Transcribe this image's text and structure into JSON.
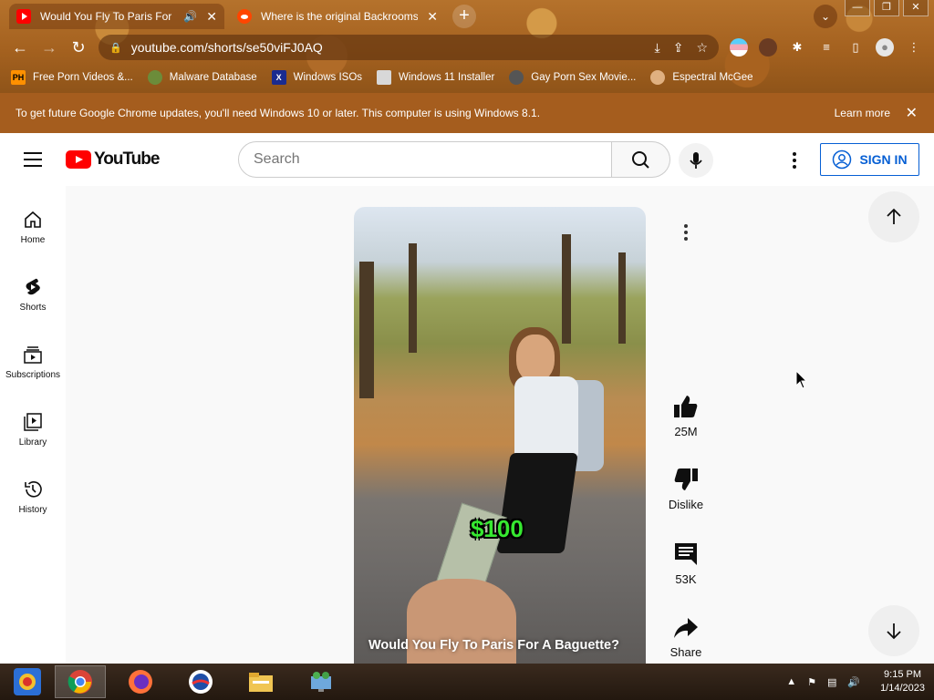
{
  "browser": {
    "tabs": [
      {
        "title": "Would You Fly To Paris For A",
        "favicon": "youtube-favicon",
        "audio": true,
        "active": true
      },
      {
        "title": "Where is the original Backrooms",
        "favicon": "reddit-favicon",
        "audio": false,
        "active": false
      }
    ],
    "new_tab_label": "+",
    "url": "youtube.com/shorts/se50viFJ0AQ",
    "bookmarks": [
      {
        "label": "Free Porn Videos &...",
        "icon": "ph-icon"
      },
      {
        "label": "Malware Database",
        "icon": "leaf-icon"
      },
      {
        "label": "Windows ISOs",
        "icon": "x-icon"
      },
      {
        "label": "Windows 11 Installer",
        "icon": "installer-icon"
      },
      {
        "label": "Gay Porn Sex Movie...",
        "icon": "globe-icon"
      },
      {
        "label": "Espectral McGee",
        "icon": "avatar-icon"
      }
    ],
    "ph_badge": "PH",
    "x_badge": "X"
  },
  "infobar": {
    "message": "To get future Google Chrome updates, you'll need Windows 10 or later. This computer is using Windows 8.1.",
    "learn_more": "Learn more"
  },
  "youtube": {
    "logo_text": "YouTube",
    "search_placeholder": "Search",
    "sign_in": "SIGN IN",
    "guide": [
      {
        "label": "Home",
        "icon": "home-icon"
      },
      {
        "label": "Shorts",
        "icon": "shorts-icon"
      },
      {
        "label": "Subscriptions",
        "icon": "subscriptions-icon"
      },
      {
        "label": "Library",
        "icon": "library-icon"
      },
      {
        "label": "History",
        "icon": "history-icon"
      }
    ],
    "short": {
      "title": "Would You Fly To Paris For A Baguette?",
      "overlay_text": "$100",
      "likes": "25M",
      "dislike_label": "Dislike",
      "comments": "53K",
      "share_label": "Share"
    }
  },
  "taskbar": {
    "time": "9:15 PM",
    "date": "1/14/2023",
    "apps": [
      "start-icon",
      "chrome-icon",
      "firefox-icon",
      "opera-icon",
      "file-explorer-icon",
      "network-app-icon"
    ]
  },
  "colors": {
    "youtube_red": "#ff0000",
    "signin_blue": "#065fd4",
    "infobar": "#a55d1e",
    "money_green": "#36e830"
  }
}
